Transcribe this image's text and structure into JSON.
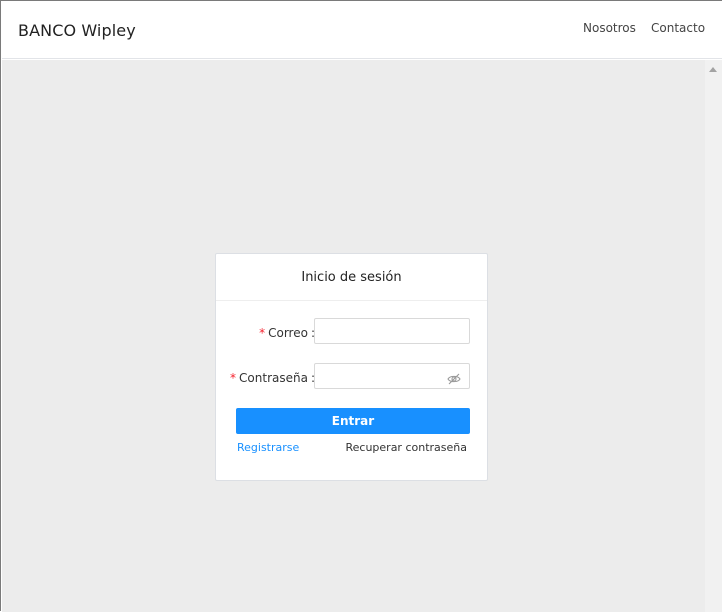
{
  "navbar": {
    "brand": "BANCO Wipley",
    "links": [
      "Nosotros",
      "Contacto"
    ]
  },
  "login": {
    "title": "Inicio de sesión",
    "required_mark": "*",
    "colon": ":",
    "email_label": "Correo",
    "email_value": "",
    "password_label": "Contraseña",
    "password_value": "",
    "submit_label": "Entrar",
    "register_link": "Registrarse",
    "recover_link": "Recuperar contraseña"
  },
  "icons": {
    "password_toggle": "eye-slash-icon",
    "scroll_up": "scroll-up-arrow-icon"
  },
  "colors": {
    "primary": "#1890ff",
    "required": "#f5222d",
    "background": "#ececec"
  }
}
